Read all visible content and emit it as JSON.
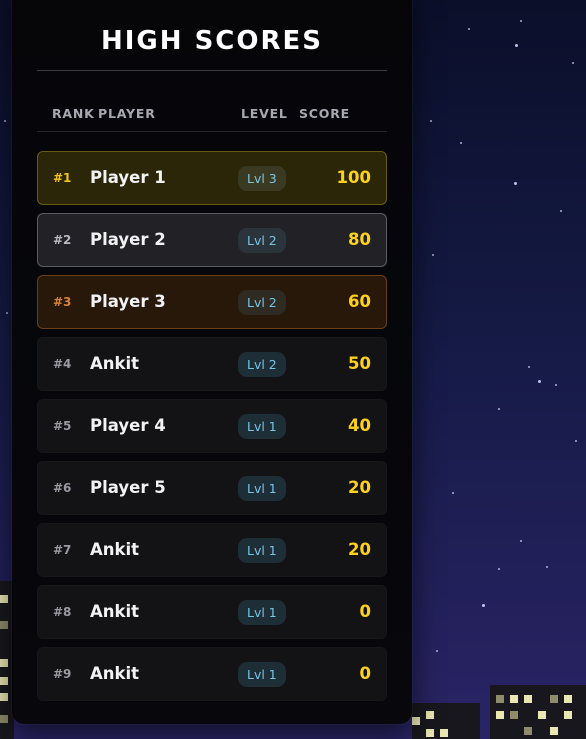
{
  "scoreboard": {
    "title": "HIGH SCORES",
    "headers": {
      "rank": "RANK",
      "player": "PLAYER",
      "level": "LEVEL",
      "score": "SCORE"
    },
    "rows": [
      {
        "rank": "#1",
        "player": "Player 1",
        "level": "Lvl 3",
        "score": "100"
      },
      {
        "rank": "#2",
        "player": "Player 2",
        "level": "Lvl 2",
        "score": "80"
      },
      {
        "rank": "#3",
        "player": "Player 3",
        "level": "Lvl 2",
        "score": "60"
      },
      {
        "rank": "#4",
        "player": "Ankit",
        "level": "Lvl 2",
        "score": "50"
      },
      {
        "rank": "#5",
        "player": "Player 4",
        "level": "Lvl 1",
        "score": "40"
      },
      {
        "rank": "#6",
        "player": "Player 5",
        "level": "Lvl 1",
        "score": "20"
      },
      {
        "rank": "#7",
        "player": "Ankit",
        "level": "Lvl 1",
        "score": "20"
      },
      {
        "rank": "#8",
        "player": "Ankit",
        "level": "Lvl 1",
        "score": "0"
      },
      {
        "rank": "#9",
        "player": "Ankit",
        "level": "Lvl 1",
        "score": "0"
      }
    ]
  },
  "colors": {
    "score": "#ffd21a",
    "rank1": "#f0c419",
    "rank2": "#b9b9c2",
    "rank3": "#d9823a",
    "level_badge_text": "#78c3e6"
  }
}
